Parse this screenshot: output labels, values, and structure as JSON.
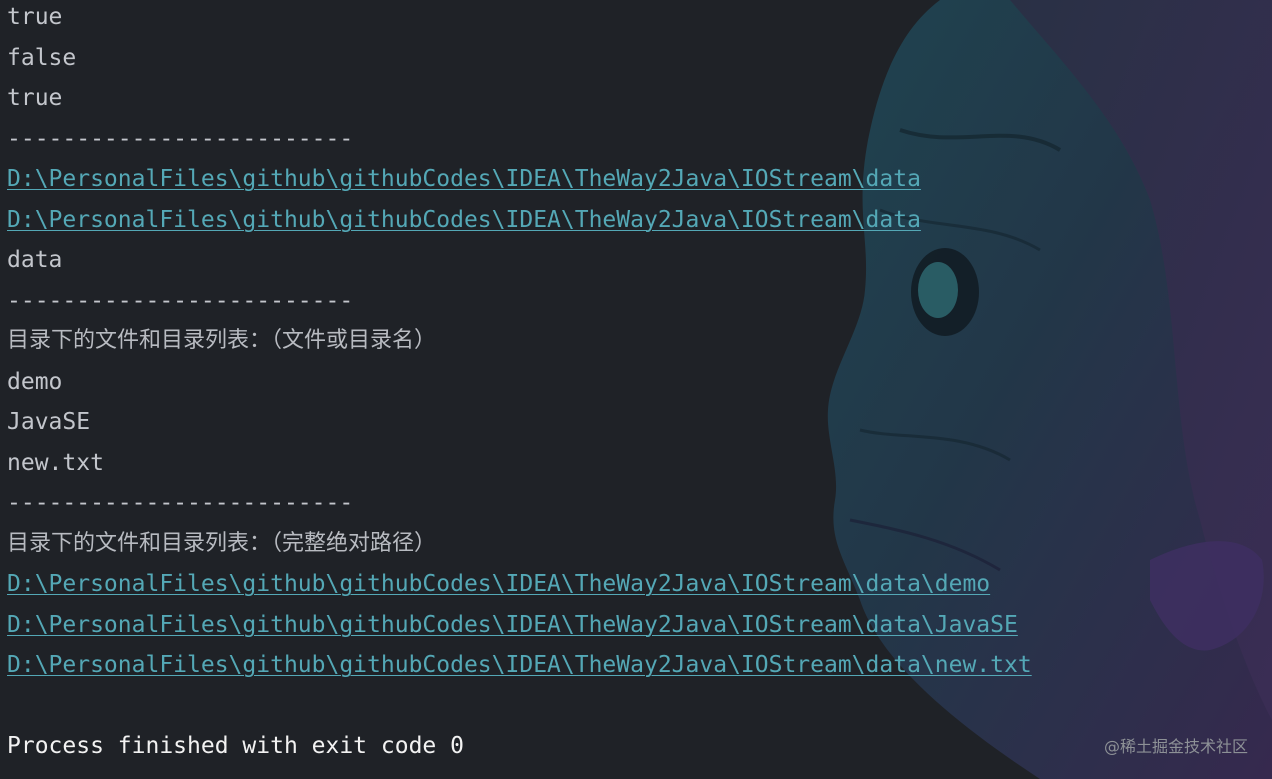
{
  "console": {
    "lines": [
      {
        "text": "true",
        "kind": "stdout"
      },
      {
        "text": "false",
        "kind": "stdout"
      },
      {
        "text": "true",
        "kind": "stdout"
      },
      {
        "text": "-------------------------",
        "kind": "separator"
      },
      {
        "text": "D:\\PersonalFiles\\github\\githubCodes\\IDEA\\TheWay2Java\\IOStream\\data",
        "kind": "path-link"
      },
      {
        "text": "D:\\PersonalFiles\\github\\githubCodes\\IDEA\\TheWay2Java\\IOStream\\data",
        "kind": "path-link"
      },
      {
        "text": "data",
        "kind": "stdout"
      },
      {
        "text": "-------------------------",
        "kind": "separator"
      },
      {
        "text": "目录下的文件和目录列表：（文件或目录名）",
        "kind": "cjk"
      },
      {
        "text": "demo",
        "kind": "stdout"
      },
      {
        "text": "JavaSE",
        "kind": "stdout"
      },
      {
        "text": "new.txt",
        "kind": "stdout"
      },
      {
        "text": "-------------------------",
        "kind": "separator"
      },
      {
        "text": "目录下的文件和目录列表：（完整绝对路径）",
        "kind": "cjk"
      },
      {
        "text": "D:\\PersonalFiles\\github\\githubCodes\\IDEA\\TheWay2Java\\IOStream\\data\\demo",
        "kind": "path-link"
      },
      {
        "text": "D:\\PersonalFiles\\github\\githubCodes\\IDEA\\TheWay2Java\\IOStream\\data\\JavaSE",
        "kind": "path-link"
      },
      {
        "text": "D:\\PersonalFiles\\github\\githubCodes\\IDEA\\TheWay2Java\\IOStream\\data\\new.txt",
        "kind": "path-link"
      },
      {
        "text": "",
        "kind": "blank"
      },
      {
        "text": "Process finished with exit code 0",
        "kind": "status"
      }
    ]
  },
  "watermark": "@稀土掘金技术社区",
  "colors": {
    "background": "#1f2227",
    "stdout": "#c3c6cc",
    "link": "#54a8b6",
    "status": "#f2f2f2"
  },
  "background_art": "character-profile-artwork"
}
